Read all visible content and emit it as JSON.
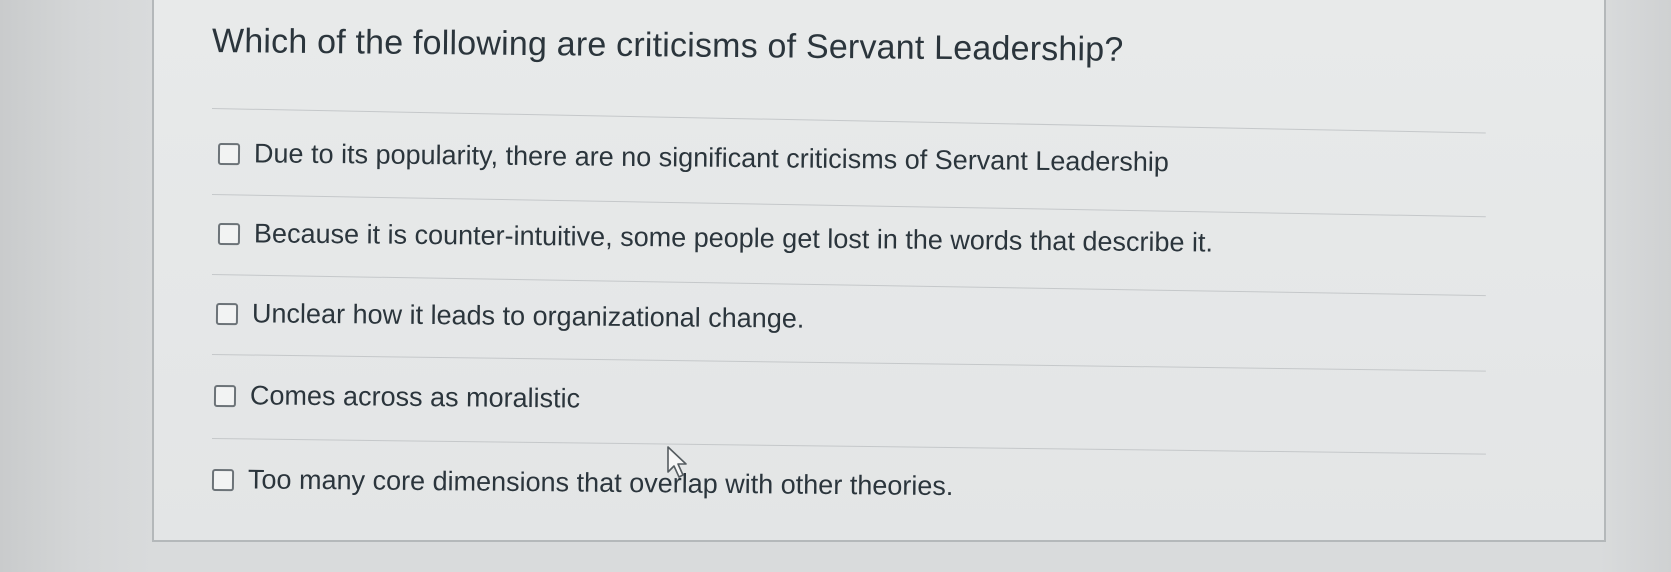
{
  "question": {
    "text": "Which of the following are criticisms of Servant Leadership?"
  },
  "options": [
    {
      "label": "Due to its popularity, there are no significant criticisms of Servant Leadership",
      "checked": false
    },
    {
      "label": "Because it is counter-intuitive, some people get lost in the words that describe it.",
      "checked": false
    },
    {
      "label": "Unclear how it leads to organizational change.",
      "checked": false
    },
    {
      "label": "Comes across as moralistic",
      "checked": false
    },
    {
      "label": "Too many core dimensions that overlap with other theories.",
      "checked": false
    }
  ],
  "icons": {
    "checkbox": "empty-checkbox-icon",
    "pointer": "mouse-pointer-icon"
  },
  "colors": {
    "text": "#2b353c",
    "card_background": "#e6e8e8",
    "divider": "#c5c8ca",
    "checkbox_border": "#6c7378"
  }
}
